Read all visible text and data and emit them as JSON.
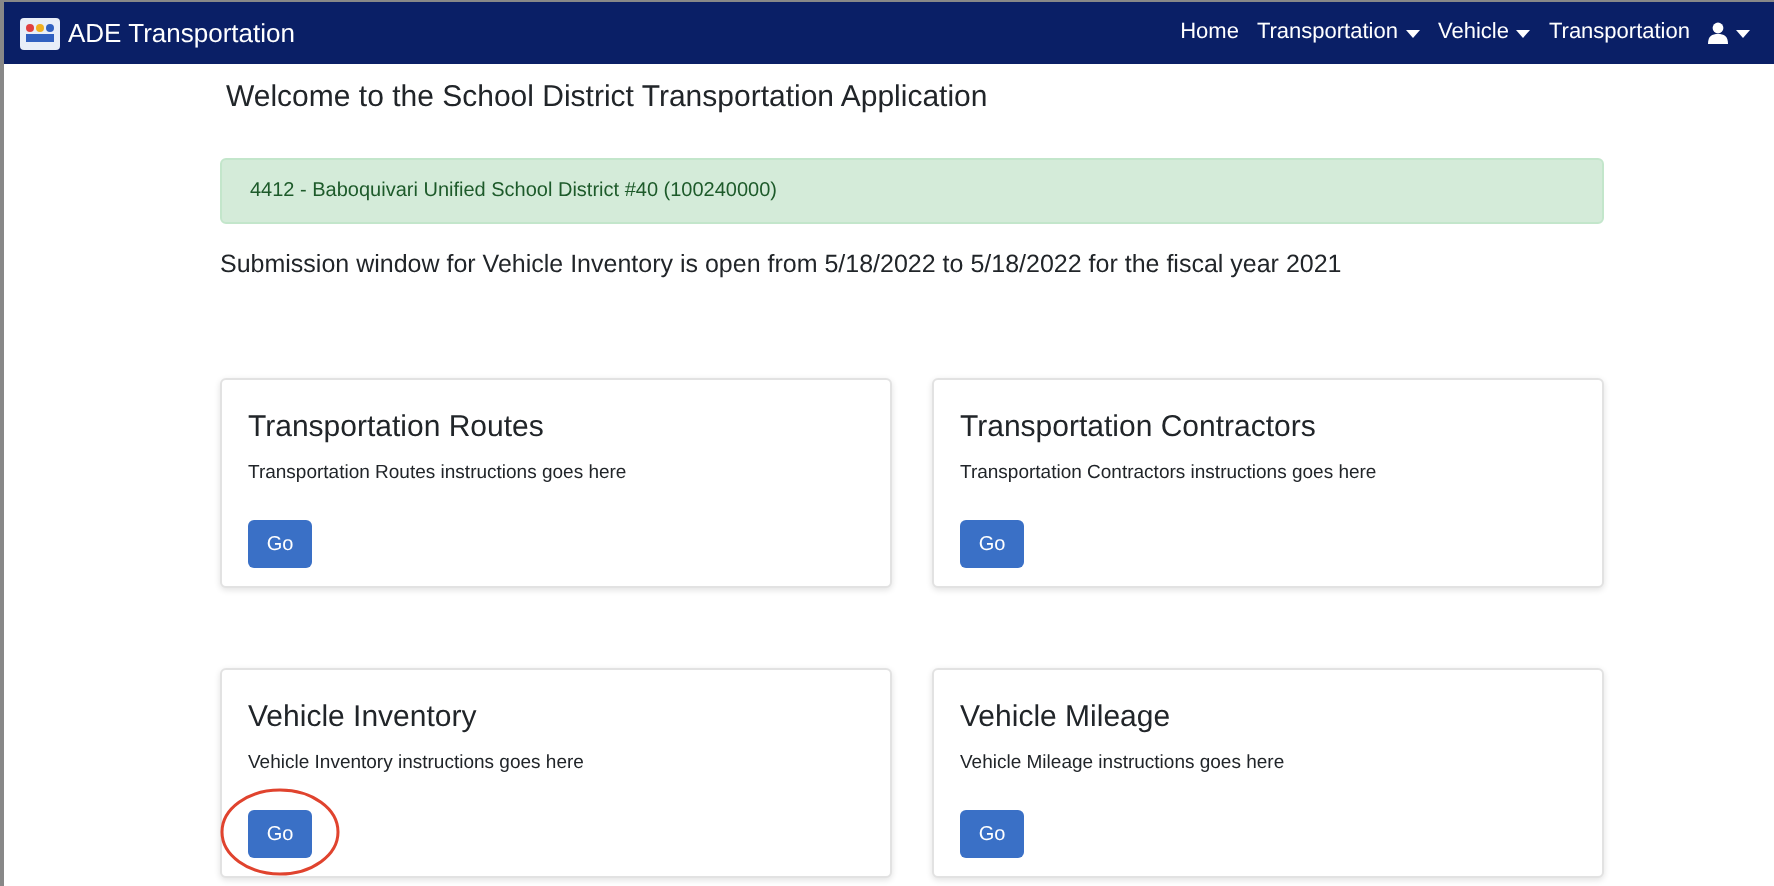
{
  "navbar": {
    "brand": "ADE Transportation",
    "items": [
      {
        "label": "Home",
        "kind": "link"
      },
      {
        "label": "Transportation",
        "kind": "dropdown"
      },
      {
        "label": "Vehicle",
        "kind": "dropdown"
      },
      {
        "label": "Transportation",
        "kind": "link"
      },
      {
        "kind": "user-dropdown"
      }
    ]
  },
  "heading": "Welcome to the School District Transportation Application",
  "district_alert": "4412 - Baboquivari Unified School District #40 (100240000)",
  "submission_notice": "Submission window for Vehicle Inventory is open from 5/18/2022 to 5/18/2022 for the fiscal year 2021",
  "cards": [
    {
      "title": "Transportation Routes",
      "text": "Transportation Routes instructions goes here",
      "button": "Go",
      "circled": false
    },
    {
      "title": "Transportation Contractors",
      "text": "Transportation Contractors instructions goes here",
      "button": "Go",
      "circled": false
    },
    {
      "title": "Vehicle Inventory",
      "text": "Vehicle Inventory instructions goes here",
      "button": "Go",
      "circled": true
    },
    {
      "title": "Vehicle Mileage",
      "text": "Vehicle Mileage instructions goes here",
      "button": "Go",
      "circled": false
    }
  ]
}
